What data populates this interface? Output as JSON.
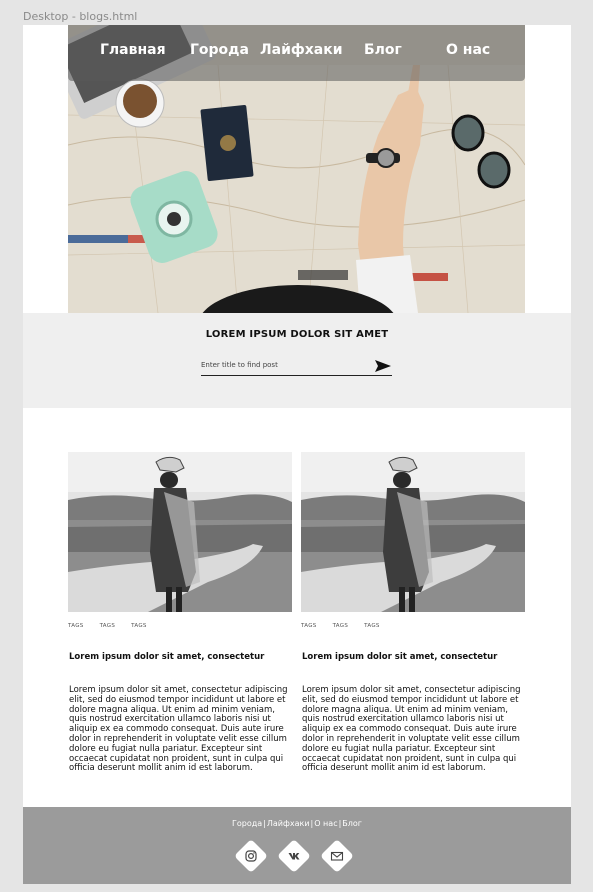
{
  "frame_label": "Desktop - blogs.html",
  "nav": {
    "items": [
      "Главная",
      "Города",
      "Лайфхаки",
      "Блог",
      "О нас"
    ]
  },
  "search": {
    "title": "LOREM IPSUM DOLOR SIT AMET",
    "placeholder": "Enter title to find post",
    "submit_icon": "send-arrow-icon"
  },
  "posts": [
    {
      "tags": [
        "TAGS",
        "TAGS",
        "TAGS"
      ],
      "title": "Lorem ipsum dolor sit amet, consectetur",
      "body": "Lorem ipsum dolor sit amet, consectetur adipiscing elit, sed do eiusmod tempor incididunt ut labore et dolore magna aliqua. Ut enim ad minim veniam, quis nostrud exercitation ullamco laboris nisi ut aliquip ex ea commodo consequat. Duis aute irure dolor in reprehenderit in voluptate velit esse cillum dolore eu fugiat nulla pariatur. Excepteur sint occaecat cupidatat non proident, sunt in culpa qui officia deserunt mollit anim id est laborum."
    },
    {
      "tags": [
        "TAGS",
        "TAGS",
        "TAGS"
      ],
      "title": "Lorem ipsum dolor sit amet, consectetur",
      "body": "Lorem ipsum dolor sit amet, consectetur adipiscing elit, sed do eiusmod tempor incididunt ut labore et dolore magna aliqua. Ut enim ad minim veniam, quis nostrud exercitation ullamco laboris nisi ut aliquip ex ea commodo consequat. Duis aute irure dolor in reprehenderit in voluptate velit esse cillum dolore eu fugiat nulla pariatur. Excepteur sint occaecat cupidatat non proident, sunt in culpa qui officia deserunt mollit anim id est laborum."
    }
  ],
  "footer": {
    "links": [
      "Города",
      "Лайфхаки",
      "О нас",
      "Блог"
    ],
    "social_icons": [
      "instagram-icon",
      "vk-icon",
      "mail-icon"
    ]
  },
  "colors": {
    "footer_bg": "#9b9b9b",
    "search_band_bg": "#efefef",
    "nav_overlay": "rgba(90,90,90,0.55)"
  }
}
